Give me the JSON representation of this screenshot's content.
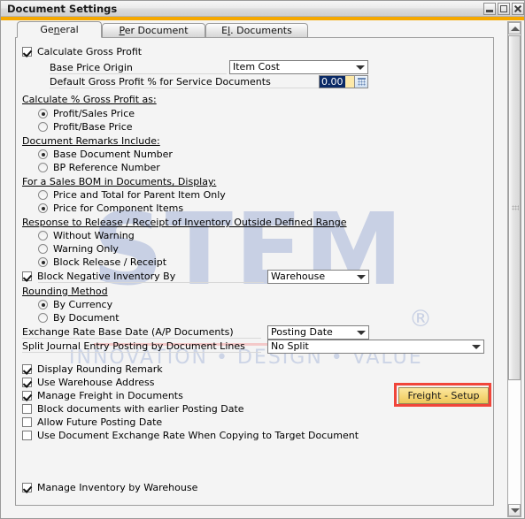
{
  "window": {
    "title": "Document Settings",
    "buttons": {
      "minimize": "minimize",
      "maximize": "maximize",
      "close": "close"
    },
    "accent_color": "#f5a800"
  },
  "tabs": [
    {
      "label": "General",
      "mnemonic": "n",
      "active": true
    },
    {
      "label": "Per Document",
      "mnemonic": "P",
      "active": false
    },
    {
      "label": "El. Documents",
      "mnemonic": "l",
      "active": false
    }
  ],
  "watermark": {
    "text": "STEM",
    "registered": "®",
    "tagline": "INNOVATION  •  DESIGN  •  VALUE",
    "color": "#c8d0e4",
    "rule_color": "#f4c9c9"
  },
  "form": {
    "calculate_gross_profit": {
      "label": "Calculate Gross Profit",
      "checked": true
    },
    "base_price_origin": {
      "label": "Base Price Origin",
      "value": "Item Cost"
    },
    "default_gross_profit_pct": {
      "label": "Default Gross Profit % for Service Documents",
      "value": "0.00",
      "selected": true,
      "picker_icon": "calculator-icon"
    },
    "calculate_pct_group": {
      "header": "Calculate % Gross Profit as:",
      "options": [
        {
          "label": "Profit/Sales Price",
          "selected": true
        },
        {
          "label": "Profit/Base Price",
          "selected": false
        }
      ]
    },
    "document_remarks_group": {
      "header": "Document Remarks Include:",
      "options": [
        {
          "label": "Base Document Number",
          "selected": true
        },
        {
          "label": "BP Reference Number",
          "selected": false
        }
      ]
    },
    "sales_bom_group": {
      "header": "For a Sales BOM in Documents, Display:",
      "options": [
        {
          "label": "Price and Total for Parent Item Only",
          "selected": false
        },
        {
          "label": "Price for Component Items",
          "selected": true
        }
      ]
    },
    "response_release_group": {
      "header": "Response to Release / Receipt of Inventory Outside Defined Range",
      "options": [
        {
          "label": "Without Warning",
          "selected": false
        },
        {
          "label": "Warning Only",
          "selected": false
        },
        {
          "label": "Block Release / Receipt",
          "selected": true
        }
      ]
    },
    "block_negative_inventory": {
      "label": "Block Negative Inventory By",
      "checked": true,
      "value": "Warehouse"
    },
    "rounding_method_group": {
      "header": "Rounding Method",
      "options": [
        {
          "label": "By Currency",
          "selected": true
        },
        {
          "label": "By Document",
          "selected": false
        }
      ]
    },
    "exchange_rate_base_date": {
      "label": "Exchange Rate Base Date (A/P Documents)",
      "value": "Posting Date"
    },
    "split_journal_entry": {
      "label": "Split Journal Entry Posting by Document Lines",
      "value": "No Split"
    },
    "checkboxes": [
      {
        "label": "Display Rounding Remark",
        "checked": true
      },
      {
        "label": "Use Warehouse Address",
        "checked": true
      },
      {
        "label": "Manage Freight in Documents",
        "checked": true
      },
      {
        "label": "Block documents with earlier Posting Date",
        "checked": false
      },
      {
        "label": "Allow Future Posting Date",
        "checked": false
      },
      {
        "label": "Use Document Exchange Rate When Copying to Target Document",
        "checked": false
      }
    ],
    "manage_inventory_by_warehouse": {
      "label": "Manage Inventory by Warehouse",
      "checked": true
    },
    "freight_setup_button": {
      "label": "Freight - Setup",
      "highlight_color": "#f0453a"
    }
  }
}
